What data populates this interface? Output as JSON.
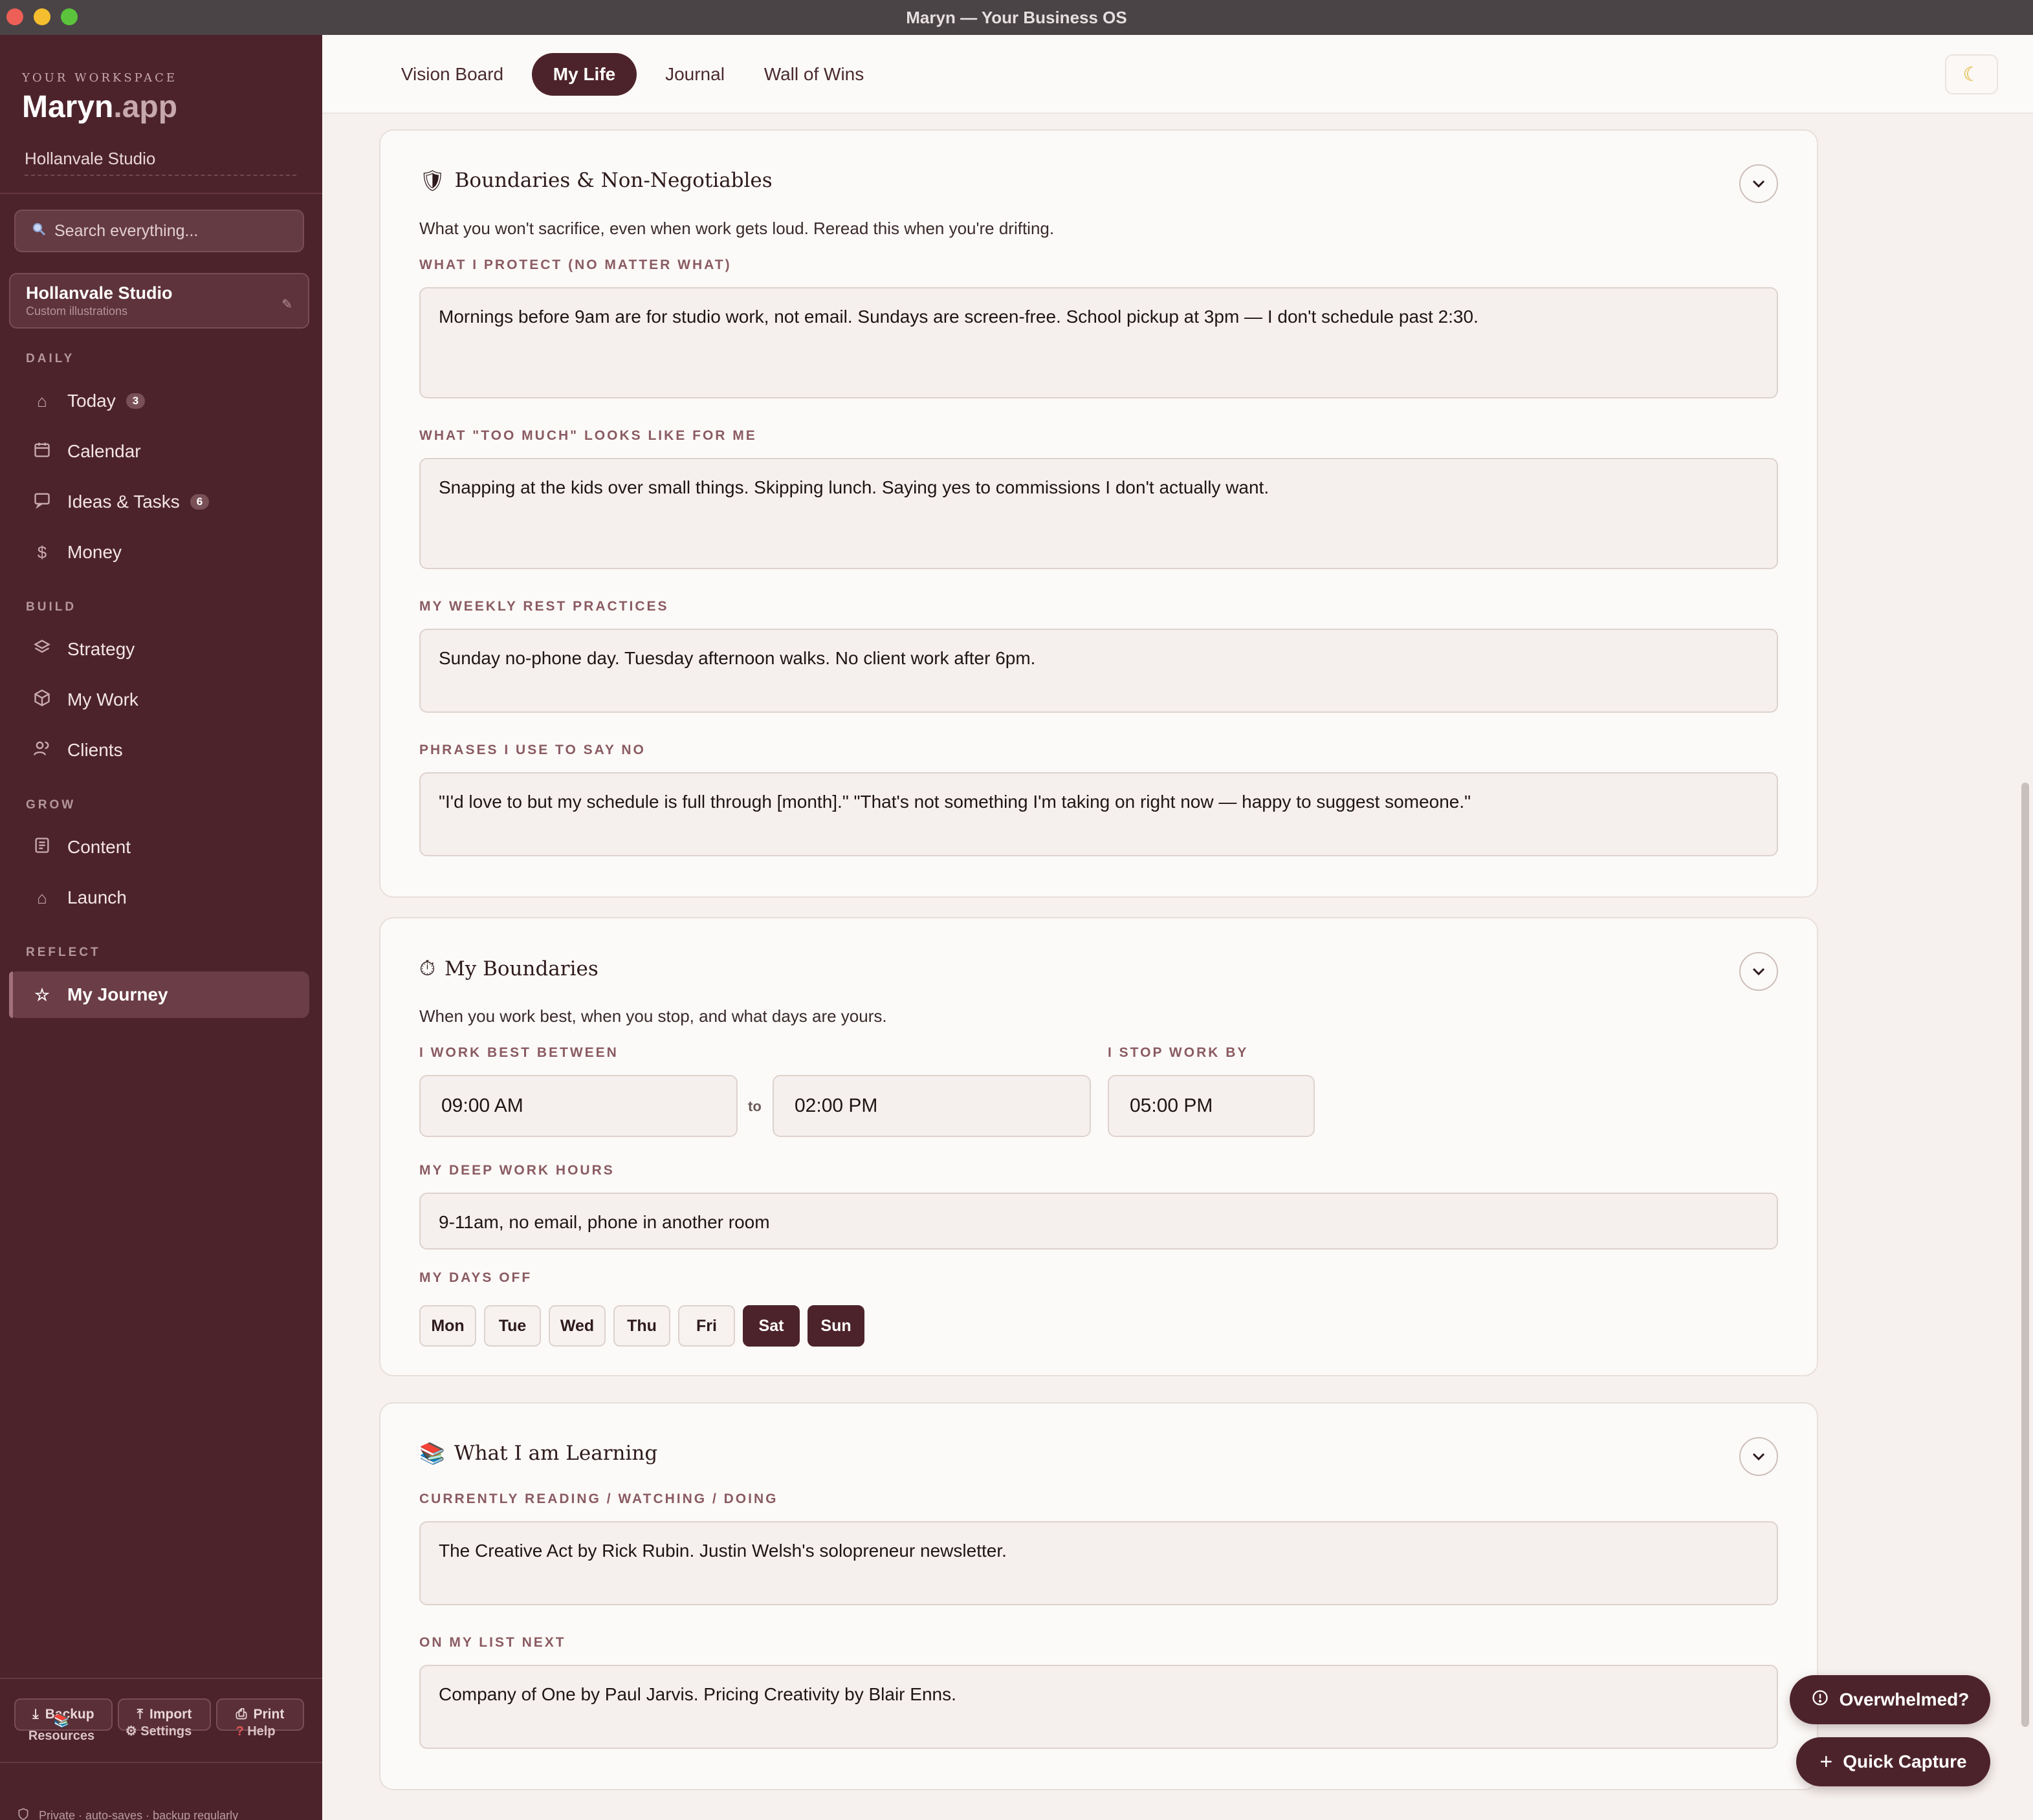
{
  "window": {
    "title": "Maryn — Your Business OS"
  },
  "sidebar": {
    "workspace_label": "YOUR WORKSPACE",
    "brand_main": "Maryn",
    "brand_suffix": ".app",
    "studio_name": "Hollanvale Studio",
    "search_placeholder": "Search everything...",
    "workspace_card": {
      "name": "Hollanvale Studio",
      "subtitle": "Custom illustrations"
    },
    "sections": [
      {
        "label": "DAILY",
        "items": [
          {
            "label": "Today",
            "icon": "home-icon",
            "badge": "3"
          },
          {
            "label": "Calendar",
            "icon": "calendar-icon"
          },
          {
            "label": "Ideas & Tasks",
            "icon": "inbox-icon",
            "badge": "6"
          },
          {
            "label": "Money",
            "icon": "dollar-icon"
          }
        ]
      },
      {
        "label": "BUILD",
        "items": [
          {
            "label": "Strategy",
            "icon": "layers-icon"
          },
          {
            "label": "My Work",
            "icon": "box-icon"
          },
          {
            "label": "Clients",
            "icon": "users-icon"
          }
        ]
      },
      {
        "label": "GROW",
        "items": [
          {
            "label": "Content",
            "icon": "document-icon"
          },
          {
            "label": "Launch",
            "icon": "rocket-icon"
          }
        ]
      },
      {
        "label": "REFLECT",
        "items": [
          {
            "label": "My Journey",
            "icon": "star-icon",
            "active": true
          }
        ]
      }
    ],
    "footer_buttons": {
      "backup": "Backup",
      "import": "Import",
      "print": "Print"
    },
    "footer_links": {
      "resources": "Resources",
      "settings": "Settings",
      "help": "Help"
    },
    "privacy_note": "Private · auto-saves · backup regularly"
  },
  "tabs": [
    {
      "label": "Vision Board"
    },
    {
      "label": "My Life",
      "active": true
    },
    {
      "label": "Journal"
    },
    {
      "label": "Wall of Wins"
    }
  ],
  "boundaries_card": {
    "emoji": "🛡",
    "title": "Boundaries & Non-Negotiables",
    "description": "What you won't sacrifice, even when work gets loud. Reread this when you're drifting.",
    "fields": [
      {
        "label": "WHAT I PROTECT (NO MATTER WHAT)",
        "value": "Mornings before 9am are for studio work, not email. Sundays are screen-free. School pickup at 3pm — I don't schedule past 2:30."
      },
      {
        "label": "WHAT \"TOO MUCH\" LOOKS LIKE FOR ME",
        "value": "Snapping at the kids over small things. Skipping lunch. Saying yes to commissions I don't actually want."
      },
      {
        "label": "MY WEEKLY REST PRACTICES",
        "value": "Sunday no-phone day. Tuesday afternoon walks. No client work after 6pm."
      },
      {
        "label": "PHRASES I USE TO SAY NO",
        "value": "\"I'd love to but my schedule is full through [month].\" \"That's not something I'm taking on right now — happy to suggest someone.\""
      }
    ]
  },
  "my_boundaries_card": {
    "emoji": "⏱",
    "title": "My Boundaries",
    "description": "When you work best, when you stop, and what days are yours.",
    "work_best_label": "I WORK BEST BETWEEN",
    "work_start": "09:00 AM",
    "to_label": "to",
    "work_end": "02:00 PM",
    "stop_label": "I STOP WORK BY",
    "stop_time": "05:00 PM",
    "deep_work_label": "MY DEEP WORK HOURS",
    "deep_work_value": "9-11am, no email, phone in another room",
    "days_off_label": "MY DAYS OFF",
    "days": [
      {
        "label": "Mon",
        "off": false
      },
      {
        "label": "Tue",
        "off": false
      },
      {
        "label": "Wed",
        "off": false
      },
      {
        "label": "Thu",
        "off": false
      },
      {
        "label": "Fri",
        "off": false
      },
      {
        "label": "Sat",
        "off": true
      },
      {
        "label": "Sun",
        "off": true
      }
    ]
  },
  "learning_card": {
    "emoji": "📚",
    "title": "What I am Learning",
    "fields": [
      {
        "label": "CURRENTLY READING / WATCHING / DOING",
        "value": "The Creative Act by Rick Rubin. Justin Welsh's solopreneur newsletter."
      },
      {
        "label": "ON MY LIST NEXT",
        "value": "Company of One by Paul Jarvis. Pricing Creativity by Blair Enns."
      }
    ]
  },
  "floating": {
    "overwhelmed": "Overwhelmed?",
    "quick_capture": "Quick Capture"
  },
  "colors": {
    "brand": "#4d232b",
    "sidebar_bg": "#4d232b",
    "page_bg": "#f6f1ee",
    "card_bg": "#fcfaf8",
    "label": "#8a5b62"
  }
}
